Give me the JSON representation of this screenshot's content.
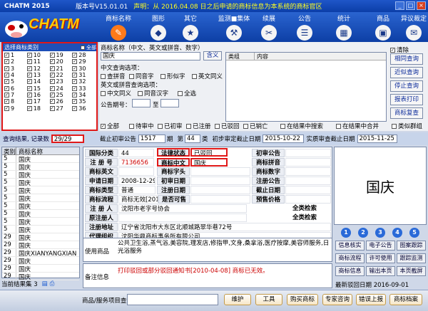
{
  "window": {
    "app_name": "CHATM 2015",
    "version": "版本号V15.01.01",
    "announcement": "声明：从 2016.04.08 日之后申请的商标信息为本系统的商标官区"
  },
  "nav": {
    "brand": "CHATM",
    "items": [
      {
        "label": "商标名称",
        "icon": "pencil-icon"
      },
      {
        "label": "图形",
        "icon": "shapes-icon"
      },
      {
        "label": "其它",
        "icon": "star-icon"
      },
      {
        "label": "监测■集体",
        "icon": "tools-icon"
      },
      {
        "label": "续展",
        "icon": "wrench-icon"
      },
      {
        "label": "公告",
        "icon": "book-icon"
      },
      {
        "label": "统计",
        "icon": "chart-icon"
      },
      {
        "label": "商品",
        "icon": "box-icon"
      },
      {
        "label": "异议裁定",
        "icon": "document-icon"
      }
    ]
  },
  "classes": {
    "header": "选择商标类别",
    "select_all": "全部",
    "rows": [
      [
        "1",
        "10",
        "19",
        "28"
      ],
      [
        "2",
        "11",
        "20",
        "29"
      ],
      [
        "3",
        "12",
        "21",
        "30"
      ],
      [
        "4",
        "13",
        "22",
        "31"
      ],
      [
        "5",
        "14",
        "23",
        "32"
      ],
      [
        "6",
        "15",
        "24",
        "33"
      ],
      [
        "7",
        "16",
        "25",
        "34"
      ],
      [
        "8",
        "17",
        "26",
        "35"
      ],
      [
        "9",
        "18",
        "27",
        "36"
      ]
    ]
  },
  "query": {
    "name_label": "商标名称（中文、英文或拼音、数字）",
    "name_value": "国庆",
    "contains_btn": "含义",
    "clear_label": "清除",
    "cn_options_label": "中文查询选项：",
    "cn_options": [
      "查拼音",
      "同音字",
      "形似字",
      "英文同义"
    ],
    "en_options_label": "英文或拼音查询选项：",
    "en_options": [
      "中文同义",
      "同音汉字",
      "全选"
    ],
    "issue_label": "公告期号：",
    "issue_to": "至",
    "table_headers": [
      "类组",
      "内容"
    ],
    "status_checks": [
      "全部",
      "待审中",
      "已初审",
      "已注册",
      "已驳回",
      "已销亡"
    ],
    "search_in": "在结果中搜索",
    "merge": "在结果中合并",
    "similar": "类似群组",
    "side_buttons": [
      "相同查询",
      "近似查询",
      "停止查询",
      "报表打印",
      "商标复查"
    ]
  },
  "status": {
    "result_label": "查询结果, 记录数",
    "count": "29/29",
    "deadline_label": "截止初审公告",
    "deadline_value": "1517",
    "period": "期",
    "item_label": "第",
    "item_value": "44",
    "item_unit": "类",
    "init_label": "初步审定截止日期",
    "init_date": "2015-10-22",
    "exam_label": "实质审查截止日期",
    "exam_date": "2015-11-25"
  },
  "list": {
    "headers": [
      "类别",
      "商标名称"
    ],
    "rows": [
      [
        "5",
        "国庆"
      ],
      [
        "5",
        "国庆"
      ],
      [
        "5",
        "国庆"
      ],
      [
        "5",
        "国庆"
      ],
      [
        "5",
        "国庆"
      ],
      [
        "5",
        "国庆"
      ],
      [
        "5",
        "国庆"
      ],
      [
        "5",
        "国庆"
      ],
      [
        "5",
        "国庆"
      ],
      [
        "5",
        "国庆"
      ],
      [
        "29",
        "国庆"
      ],
      [
        "29",
        "国庆"
      ],
      [
        "29",
        "国庆XIANYANGXIAN"
      ],
      [
        "29",
        "国庆"
      ],
      [
        "29",
        "国庆"
      ],
      [
        "29",
        "国庆"
      ]
    ],
    "footer": "当前结果集 3"
  },
  "detail": {
    "intl_class_label": "国际分类",
    "intl_class": "44",
    "legal_status_label": "法律状态",
    "legal_status": "已驳回",
    "prelim_notice_label": "初审公告",
    "reg_no_label": "注 册 号",
    "reg_no": "7136656",
    "tm_cn_label": "商标中文",
    "tm_cn": "国庆",
    "tm_pinyin_label": "商标拼音",
    "tm_en_label": "商标英文",
    "tm_char_label": "商标字头",
    "tm_digit_label": "商标数字",
    "apply_date_label": "申请日期",
    "apply_date": "2008-12-29",
    "prelim_date_label": "初审日期",
    "reg_notice_label": "注册公告",
    "type_label": "商标类型",
    "type": "普通",
    "reg_date_label": "注册日期",
    "deadline_label": "截止日期",
    "flow_label": "商标流程",
    "flow": "商标无效[2016",
    "shared_label": "是否可售",
    "class_label": "预售价格",
    "applicant_label": "注 册 人",
    "applicant": "沈阳市老字号协会",
    "full_search": "全类检索",
    "orig_label": "原注册人",
    "address_label": "注册地址",
    "address": "辽宁省沈阳市大东区北顺城路翠华巷72号",
    "agent_label": "代理组织",
    "agent": "沈阳华鼎商标事务所有限公司",
    "usage_label": "使用商品",
    "usage": "公共卫生浴,蒸气浴,美容院,理发店,修指甲,文身,桑拿浴,医疗按摩,美容师服务,日光浴服务",
    "remark_label": "备注信息",
    "remark": "打印驳回或部分驳回通知书[2010-04-08] 商标已无效。"
  },
  "preview": {
    "text": "国庆",
    "numbers": [
      "1",
      "2",
      "3",
      "4",
      "5"
    ],
    "buttons": [
      "信息核实",
      "电子公告",
      "图案跟踪",
      "商标流程",
      "许可使用",
      "跟踪监测",
      "商标信息",
      "输出本页",
      "本页截屏"
    ],
    "next_date": "最新驳回日期 2016-09-01"
  },
  "bottom": {
    "goods_label": "商品/服务项目查询",
    "buttons": [
      "维护",
      "工具",
      "购买商标",
      "专家咨询",
      "错误上报",
      "商标档案"
    ]
  }
}
